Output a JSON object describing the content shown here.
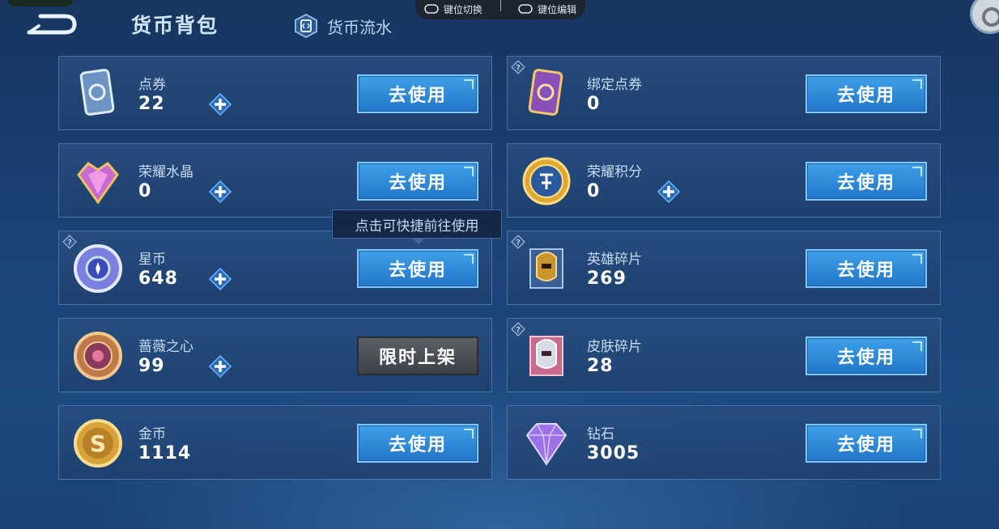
{
  "header": {
    "tab_wallet": "货币背包",
    "tab_flow": "货币流水",
    "key_switch": "键位切换",
    "key_edit": "键位编辑"
  },
  "tooltip": "点击可快捷前往使用",
  "cards": [
    {
      "name": "点券",
      "amount": "22",
      "button": "去使用",
      "icon": "coupon-icon"
    },
    {
      "name": "绑定点券",
      "amount": "0",
      "button": "去使用",
      "icon": "bound-coupon-icon"
    },
    {
      "name": "荣耀水晶",
      "amount": "0",
      "button": "去使用",
      "icon": "glory-crystal-icon"
    },
    {
      "name": "荣耀积分",
      "amount": "0",
      "button": "去使用",
      "icon": "glory-points-icon"
    },
    {
      "name": "星币",
      "amount": "648",
      "button": "去使用",
      "icon": "star-coin-icon"
    },
    {
      "name": "英雄碎片",
      "amount": "269",
      "button": "去使用",
      "icon": "hero-fragment-icon"
    },
    {
      "name": "蔷薇之心",
      "amount": "99",
      "button": "限时上架",
      "icon": "rose-heart-icon"
    },
    {
      "name": "皮肤碎片",
      "amount": "28",
      "button": "去使用",
      "icon": "skin-fragment-icon"
    },
    {
      "name": "金币",
      "amount": "1114",
      "button": "去使用",
      "icon": "gold-coin-icon"
    },
    {
      "name": "钻石",
      "amount": "3005",
      "button": "去使用",
      "icon": "diamond-icon"
    }
  ]
}
